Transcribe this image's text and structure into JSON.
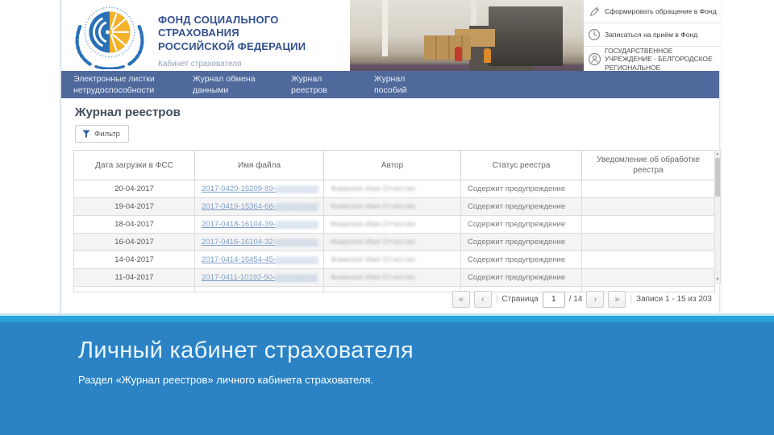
{
  "colors": {
    "nav_blue": "#50699c",
    "footer_blue": "#2b82c4",
    "footer_cyan": "#29a3d9",
    "link_blue": "#7d9dc7",
    "logo_blue": "#2a71b8",
    "logo_yellow": "#f3b229"
  },
  "header": {
    "org_line1": "ФОНД СОЦИАЛЬНОГО СТРАХОВАНИЯ",
    "org_line2": "РОССИЙСКОЙ ФЕДЕРАЦИИ",
    "cabinet_label": "Кабинет страхователя",
    "actions": [
      {
        "label": "Сформировать обращение в Фонд"
      },
      {
        "label": "Записаться на приём в Фонд"
      },
      {
        "label": "ГОСУДАРСТВЕННОЕ УЧРЕЖДЕНИЕ - БЕЛГОРОДСКОЕ РЕГИОНАЛЬНОЕ"
      }
    ]
  },
  "nav": {
    "items": [
      {
        "line1": "Электронные листки",
        "line2": "нетрудоспособности"
      },
      {
        "line1": "Журнал обмена",
        "line2": "данными"
      },
      {
        "line1": "Журнал",
        "line2": "реестров"
      },
      {
        "line1": "Журнал",
        "line2": "пособий"
      }
    ]
  },
  "page": {
    "title": "Журнал реестров",
    "filter_label": "Фильтр"
  },
  "table": {
    "columns": [
      "Дата загрузки в ФСС",
      "Имя файла",
      "Автор",
      "Статус реестра",
      "Уведомление об обработке реестра"
    ],
    "rows": [
      {
        "date": "20-04-2017",
        "file": "2017-0420-15209-89-",
        "file_redacted": "0000000000",
        "author_redacted": "Фамилия Имя Отчество",
        "status": "Содержит предупреждение",
        "notification": ""
      },
      {
        "date": "19-04-2017",
        "file": "2017-0419-15364-68-",
        "file_redacted": "0000000000",
        "author_redacted": "Фамилия Имя Отчество",
        "status": "Содержит предупреждение",
        "notification": ""
      },
      {
        "date": "18-04-2017",
        "file": "2017-0418-16104-39-",
        "file_redacted": "0000000000",
        "author_redacted": "Фамилия Имя Отчество",
        "status": "Содержит предупреждение",
        "notification": ""
      },
      {
        "date": "16-04-2017",
        "file": "2017-0416-16104-32-",
        "file_redacted": "0000000000",
        "author_redacted": "Фамилия Имя Отчество",
        "status": "Содержит предупреждение",
        "notification": ""
      },
      {
        "date": "14-04-2017",
        "file": "2017-0414-16454-45-",
        "file_redacted": "0000000000",
        "author_redacted": "Фамилия Имя Отчество",
        "status": "Содержит предупреждение",
        "notification": ""
      },
      {
        "date": "11-04-2017",
        "file": "2017-0411-10192-50-",
        "file_redacted": "0000000000",
        "author_redacted": "Фамилия Имя Отчество",
        "status": "Содержит предупреждение",
        "notification": ""
      }
    ]
  },
  "pagination": {
    "first": "«",
    "prev": "‹",
    "next": "›",
    "last": "»",
    "page_label": "Страница",
    "current_page": "1",
    "total_pages": "/ 14",
    "records": "Записи 1 - 15 из 203"
  },
  "footer": {
    "title": "Личный кабинет страхователя",
    "subtitle": "Раздел «Журнал реестров» личного кабинета страхователя."
  }
}
